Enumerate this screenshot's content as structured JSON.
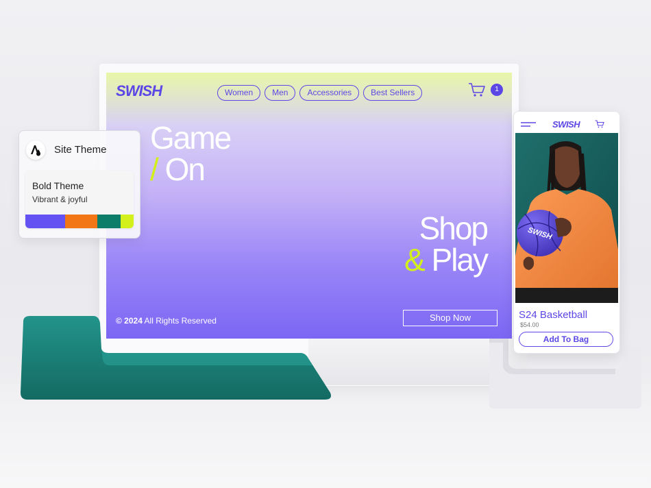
{
  "site": {
    "logo": "SWISH",
    "nav": [
      "Women",
      "Men",
      "Accessories",
      "Best Sellers"
    ],
    "cart_count": "1",
    "cart_icon": "cart-icon",
    "hero_line1": "Game",
    "hero_slash": "/",
    "hero_line2": "On",
    "shop_line1": "Shop",
    "shop_amp": "&",
    "shop_line2": "Play",
    "copyright_year": "© 2024",
    "copyright_text": "All Rights Reserved",
    "shop_button": "Shop Now",
    "colors": {
      "primary": "#5b46e6",
      "accent": "#d4f01c",
      "white": "#ffffff"
    }
  },
  "theme_panel": {
    "icon": "droplet-font-icon",
    "title": "Site Theme",
    "theme_name": "Bold Theme",
    "theme_desc": "Vibrant & joyful",
    "swatches": [
      "#6452f2",
      "#f27616",
      "#0c7d69",
      "#d4f01c"
    ]
  },
  "mobile": {
    "logo": "SWISH",
    "menu_icon": "hamburger-menu-icon",
    "cart_icon": "cart-icon",
    "ball_text": "SWISH",
    "product_name": "S24 Basketball",
    "product_price": "$54.00",
    "add_button": "Add To Bag"
  }
}
